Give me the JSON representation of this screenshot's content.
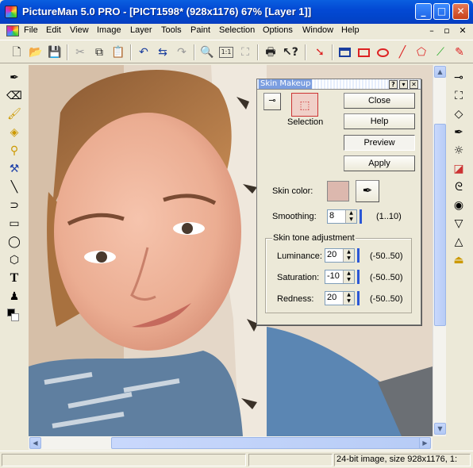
{
  "window": {
    "title": "PictureMan 5.0 PRO - [PICT1598* (928x1176) 67% [Layer 1]]",
    "minimize_glyph": "_",
    "maximize_glyph": "□",
    "close_glyph": "✕"
  },
  "menu": {
    "items": [
      "File",
      "Edit",
      "View",
      "Image",
      "Layer",
      "Tools",
      "Paint",
      "Selection",
      "Options",
      "Window",
      "Help"
    ],
    "mdi_glyphs": [
      "–",
      "▫",
      "✕"
    ]
  },
  "toolbar": {
    "icons": [
      "new-file-icon",
      "open-folder-icon",
      "save-icon",
      "cut-icon",
      "copy-icon",
      "paste-icon",
      "undo-icon",
      "flip-icon",
      "redo-icon",
      "zoom-icon",
      "actual-size-icon",
      "fit-window-icon",
      "print-icon",
      "help-cursor-icon",
      "move-arrow-icon",
      "window-icon",
      "rect-select-icon",
      "ellipse-select-icon",
      "line-icon",
      "polygon-icon",
      "magic-wand-icon",
      "pen-icon"
    ]
  },
  "left_tools": {
    "icons": [
      "eyedropper-icon",
      "eraser-icon",
      "brush-icon",
      "fill-bucket-icon",
      "stamp-icon",
      "retouch-icon",
      "line-tool-icon",
      "curve-tool-icon",
      "rectangle-tool-icon",
      "ellipse-tool-icon",
      "polygon-tool-icon",
      "text-tool-icon",
      "person-tool-icon",
      "color-swatch-icon"
    ],
    "text_tool_glyph": "T"
  },
  "right_tools": {
    "icons": [
      "filter-icon",
      "crop-icon",
      "rotate-icon",
      "picker-icon",
      "sun-icon",
      "color-balance-icon",
      "swirl-icon",
      "sphere-icon",
      "funnel-icon",
      "triangle-icon",
      "level-icon"
    ]
  },
  "dialog": {
    "title": "Skin Makeup",
    "title_buttons": [
      "?",
      "▾",
      "✕"
    ],
    "selection_label": "Selection",
    "buttons": {
      "close": "Close",
      "help": "Help",
      "preview": "Preview",
      "apply": "Apply"
    },
    "skin_color_label": "Skin color:",
    "skin_color": "#dcb8ae",
    "smoothing": {
      "label": "Smoothing:",
      "value": "8",
      "range": "(1..10)"
    },
    "group_title": "Skin tone adjustment",
    "luminance": {
      "label": "Luminance:",
      "value": "20",
      "range": "(-50..50)"
    },
    "saturation": {
      "label": "Saturation:",
      "value": "-10",
      "range": "(-50..50)"
    },
    "redness": {
      "label": "Redness:",
      "value": "20",
      "range": "(-50..50)"
    }
  },
  "status": {
    "text": "24-bit image, size 928x1176, 1:"
  },
  "colors": {
    "titlebar": "#0349d4",
    "accent": "#2b57d6",
    "face": "#ece9d8"
  }
}
